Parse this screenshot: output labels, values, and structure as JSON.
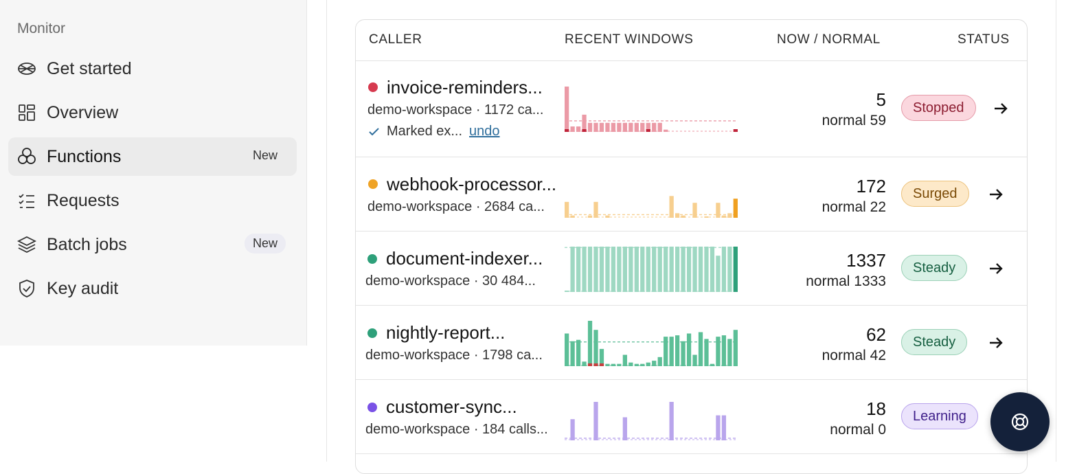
{
  "sidebar": {
    "section_label": "Monitor",
    "items": [
      {
        "label": "Get started",
        "icon": "rocket-icon",
        "badge": ""
      },
      {
        "label": "Overview",
        "icon": "grid-icon",
        "badge": ""
      },
      {
        "label": "Functions",
        "icon": "cubes-icon",
        "badge": "New"
      },
      {
        "label": "Requests",
        "icon": "checklist-icon",
        "badge": ""
      },
      {
        "label": "Batch jobs",
        "icon": "layers-icon",
        "badge": "New"
      },
      {
        "label": "Key audit",
        "icon": "shield-check-icon",
        "badge": ""
      }
    ]
  },
  "table": {
    "headers": {
      "caller": "CALLER",
      "windows": "RECENT WINDOWS",
      "now_normal": "NOW / NORMAL",
      "status": "STATUS"
    },
    "rows": [
      {
        "name": "invoice-reminders...",
        "sub": "demo-workspace · 1172 ca...",
        "note": "Marked ex...",
        "undo": "undo",
        "now": "5",
        "normal": "normal 59",
        "status": "Stopped",
        "dot_color": "#d63a4f",
        "bar_color": "#eb9aa6",
        "alert_color": "#c0243a",
        "baseline_frac": 0.22,
        "bars": [
          1,
          0.12,
          0.12,
          0.38,
          0.2,
          0.2,
          0.2,
          0.2,
          0.2,
          0.2,
          0.2,
          0.2,
          0.2,
          0.2,
          0.2,
          0.2,
          0.2,
          0.05,
          0,
          0,
          0,
          0,
          0,
          0,
          0,
          0,
          0,
          0,
          0,
          0
        ],
        "alerts": [
          1,
          0,
          0,
          1,
          0,
          0,
          0,
          0,
          0,
          0,
          0,
          0,
          0,
          0,
          1,
          0,
          0,
          0,
          0,
          0,
          0,
          0,
          0,
          0,
          0,
          0,
          0,
          0,
          0,
          1
        ]
      },
      {
        "name": "webhook-processor...",
        "sub": "demo-workspace · 2684 ca...",
        "note": "",
        "undo": "",
        "now": "172",
        "normal": "normal 22",
        "status": "Surged",
        "dot_color": "#efa326",
        "bar_color": "#f7cf8f",
        "alert_color": "#f0a020",
        "baseline_frac": 0.04,
        "bars": [
          0.35,
          0.05,
          0,
          0,
          0.05,
          0.35,
          0,
          0.05,
          0,
          0,
          0,
          0,
          0,
          0,
          0,
          0,
          0,
          0,
          0.48,
          0.1,
          0.05,
          0,
          0.33,
          0,
          0.02,
          0,
          0.33,
          0.05,
          0.1,
          0.42
        ],
        "alerts": [
          0,
          0,
          0,
          0,
          0,
          0,
          0,
          0,
          0,
          0,
          0,
          0,
          0,
          0,
          0,
          0,
          0,
          0,
          0,
          0,
          0,
          0,
          0,
          0,
          0,
          0,
          0,
          0,
          0,
          1
        ]
      },
      {
        "name": "document-indexer...",
        "sub": "demo-workspace · 30 484...",
        "note": "",
        "undo": "",
        "now": "1337",
        "normal": "normal 1333",
        "status": "Steady",
        "dot_color": "#2ea07a",
        "bar_color": "#9ed8c2",
        "alert_color": "#2ea07a",
        "baseline_frac": 0.98,
        "bars": [
          0.03,
          1,
          1,
          1,
          1,
          1,
          1,
          1,
          1,
          1,
          1,
          1,
          1,
          1,
          1,
          1,
          1,
          1,
          1,
          1,
          1,
          1,
          1,
          1,
          1,
          1,
          0.8,
          1,
          1,
          1
        ],
        "alerts": [
          0,
          0,
          0,
          0,
          0,
          0,
          0,
          0,
          0,
          0,
          0,
          0,
          0,
          0,
          0,
          0,
          0,
          0,
          0,
          0,
          0,
          0,
          0,
          0,
          0,
          0,
          0,
          0,
          0,
          1
        ]
      },
      {
        "name": "nightly-report...",
        "sub": "demo-workspace · 1798 ca...",
        "note": "",
        "undo": "",
        "now": "62",
        "normal": "normal 42",
        "status": "Steady",
        "dot_color": "#2ea07a",
        "bar_color": "#5cbf97",
        "alert_color": "#c84040",
        "baseline_frac": 0.52,
        "bars": [
          0.72,
          0.55,
          0.58,
          0.1,
          1,
          0.8,
          0.38,
          0.05,
          0.05,
          0.05,
          0.25,
          0.08,
          0.05,
          0.05,
          0.08,
          0.12,
          0.2,
          0.65,
          0.65,
          0.68,
          0.55,
          0.72,
          0.25,
          0.75,
          0.6,
          0.05,
          0.65,
          0.68,
          0.6,
          0.8
        ],
        "alerts": [
          0,
          0,
          0,
          0,
          1,
          1,
          1,
          0,
          0,
          0,
          0,
          0,
          0,
          0,
          0,
          0,
          0,
          0,
          0,
          0,
          0,
          0,
          0,
          0,
          0,
          0,
          0,
          0,
          0,
          0
        ]
      },
      {
        "name": "customer-sync...",
        "sub": "demo-workspace · 184 calls...",
        "note": "",
        "undo": "",
        "now": "18",
        "normal": "normal 0",
        "status": "Learning",
        "dot_color": "#7a52e6",
        "bar_color": "#b9a5ec",
        "alert_color": "#7a52e6",
        "baseline_frac": 0.02,
        "bars": [
          0,
          0.55,
          0,
          0,
          0,
          1,
          0,
          0,
          0,
          0,
          0.6,
          0,
          0,
          0,
          0,
          0,
          0,
          0,
          1,
          0,
          0,
          0,
          0,
          0,
          0,
          0,
          0.65,
          0.65,
          0,
          0
        ],
        "alerts": [
          0,
          0,
          0,
          0,
          0,
          0,
          0,
          0,
          0,
          0,
          0,
          0,
          0,
          0,
          0,
          0,
          0,
          0,
          0,
          0,
          0,
          0,
          0,
          0,
          0,
          0,
          0,
          0,
          0,
          0
        ]
      }
    ]
  },
  "status_styles": {
    "Stopped": {
      "bg": "#fbd7de",
      "border": "#e59aa8",
      "text": "#8c1d31"
    },
    "Surged": {
      "bg": "#fde9c9",
      "border": "#ecc27c",
      "text": "#7a4a06"
    },
    "Steady": {
      "bg": "#d9f1e6",
      "border": "#9bd1b7",
      "text": "#155e40"
    },
    "Learning": {
      "bg": "#ebe3fc",
      "border": "#b8a3ec",
      "text": "#3f1f8a"
    }
  },
  "help_button_icon": "lifebuoy-icon"
}
